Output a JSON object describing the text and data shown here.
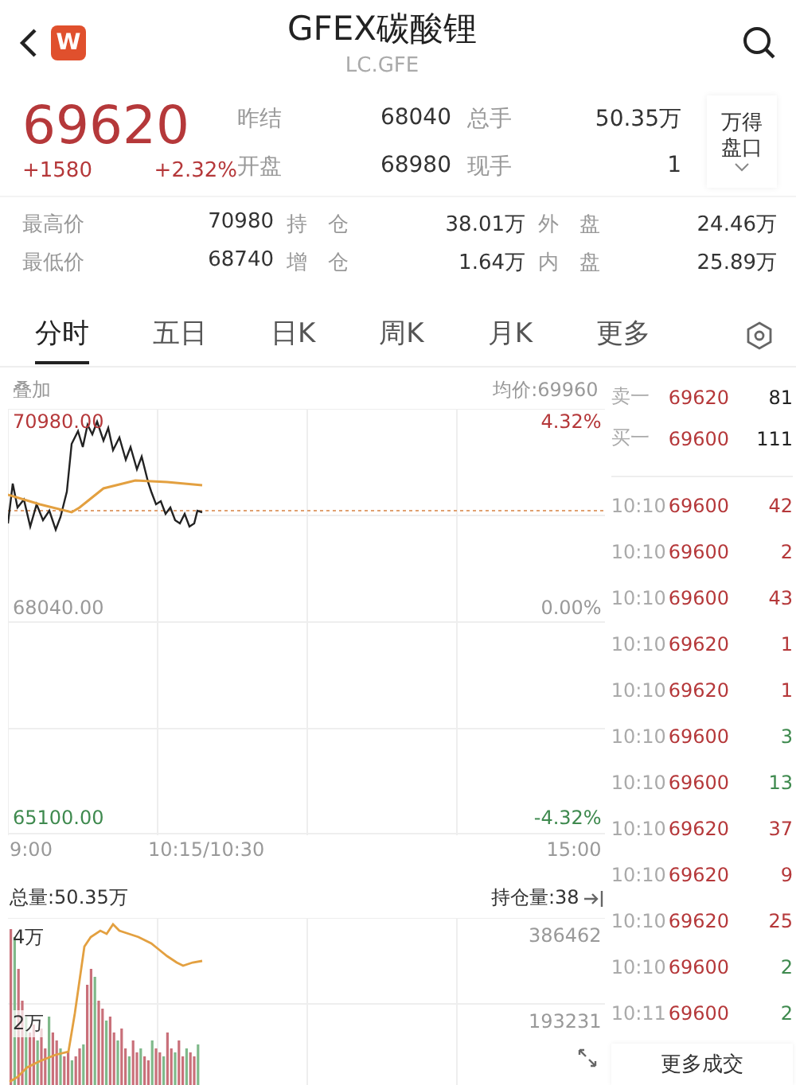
{
  "header": {
    "title": "GFEX碳酸锂",
    "subtitle": "LC.GFE",
    "logo": "W"
  },
  "quote": {
    "price": "69620",
    "change": "+1580",
    "change_pct": "+2.32%",
    "fields": [
      {
        "label": "昨结",
        "value": "68040"
      },
      {
        "label": "总手",
        "value": "50.35万"
      },
      {
        "label": "开盘",
        "value": "68980"
      },
      {
        "label": "现手",
        "value": "1"
      }
    ],
    "panel_button": [
      "万得",
      "盘口"
    ]
  },
  "stats": [
    {
      "label": "最高价",
      "value": "70980"
    },
    {
      "label": "持　仓",
      "value": "38.01万"
    },
    {
      "label": "外　盘",
      "value": "24.46万"
    },
    {
      "label": "最低价",
      "value": "68740"
    },
    {
      "label": "增　仓",
      "value": "1.64万"
    },
    {
      "label": "内　盘",
      "value": "25.89万"
    }
  ],
  "tabs": [
    {
      "label": "分时",
      "selected": true
    },
    {
      "label": "五日",
      "selected": false
    },
    {
      "label": "日K",
      "selected": false
    },
    {
      "label": "周K",
      "selected": false
    },
    {
      "label": "月K",
      "selected": false
    },
    {
      "label": "更多",
      "selected": false
    }
  ],
  "chart": {
    "overlay": "叠加",
    "avg": "均价:69960",
    "high": "70980.00",
    "mid": "68040.00",
    "low": "65100.00",
    "high_pct": "4.32%",
    "mid_pct": "0.00%",
    "low_pct": "-4.32%",
    "times": [
      "9:00",
      "10:15/10:30",
      "15:00"
    ]
  },
  "volume": {
    "total": "总量:50.35万",
    "open_interest": "持仓量:38",
    "left_ticks": [
      "4万",
      "2万"
    ],
    "right_ticks": [
      "386462",
      "193231"
    ]
  },
  "book": [
    {
      "label": "卖一",
      "price": "69620",
      "qty": "81"
    },
    {
      "label": "买一",
      "price": "69600",
      "qty": "111"
    }
  ],
  "trades": [
    {
      "time": "10:10",
      "price": "69600",
      "qty": "42",
      "color": "#b5383a"
    },
    {
      "time": "10:10",
      "price": "69600",
      "qty": "2",
      "color": "#b5383a"
    },
    {
      "time": "10:10",
      "price": "69600",
      "qty": "43",
      "color": "#b5383a"
    },
    {
      "time": "10:10",
      "price": "69620",
      "qty": "1",
      "color": "#b5383a"
    },
    {
      "time": "10:10",
      "price": "69620",
      "qty": "1",
      "color": "#b5383a"
    },
    {
      "time": "10:10",
      "price": "69600",
      "qty": "3",
      "color": "#3f8a4f"
    },
    {
      "time": "10:10",
      "price": "69600",
      "qty": "13",
      "color": "#3f8a4f"
    },
    {
      "time": "10:10",
      "price": "69620",
      "qty": "37",
      "color": "#b5383a"
    },
    {
      "time": "10:10",
      "price": "69620",
      "qty": "9",
      "color": "#b5383a"
    },
    {
      "time": "10:10",
      "price": "69620",
      "qty": "25",
      "color": "#b5383a"
    },
    {
      "time": "10:10",
      "price": "69600",
      "qty": "2",
      "color": "#3f8a4f"
    },
    {
      "time": "10:11",
      "price": "69600",
      "qty": "2",
      "color": "#3f8a4f"
    }
  ],
  "more_button": "更多成交"
}
